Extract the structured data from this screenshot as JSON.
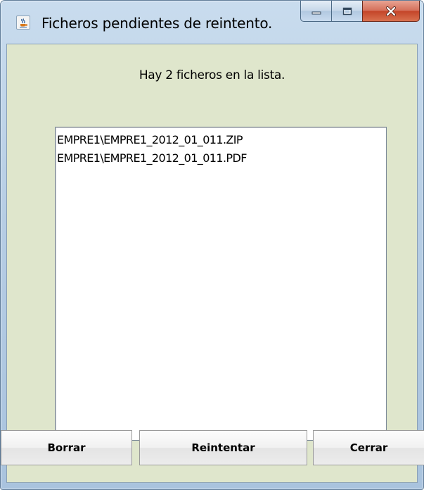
{
  "window": {
    "title": "Ficheros pendientes de reintento.",
    "icon": "java-coffee-cup-icon"
  },
  "caption_buttons": {
    "minimize": "minimize-icon",
    "maximize": "maximize-icon",
    "close": "close-icon"
  },
  "main": {
    "info_text": "Hay 2 ficheros en la lista.",
    "files": [
      "EMPRE1\\EMPRE1_2012_01_011.ZIP",
      "EMPRE1\\EMPRE1_2012_01_011.PDF"
    ]
  },
  "buttons": {
    "delete_label": "Borrar",
    "retry_label": "Reintentar",
    "close_label": "Cerrar"
  },
  "colors": {
    "client_background": "#dfe6cc",
    "close_button": "#c44529"
  }
}
